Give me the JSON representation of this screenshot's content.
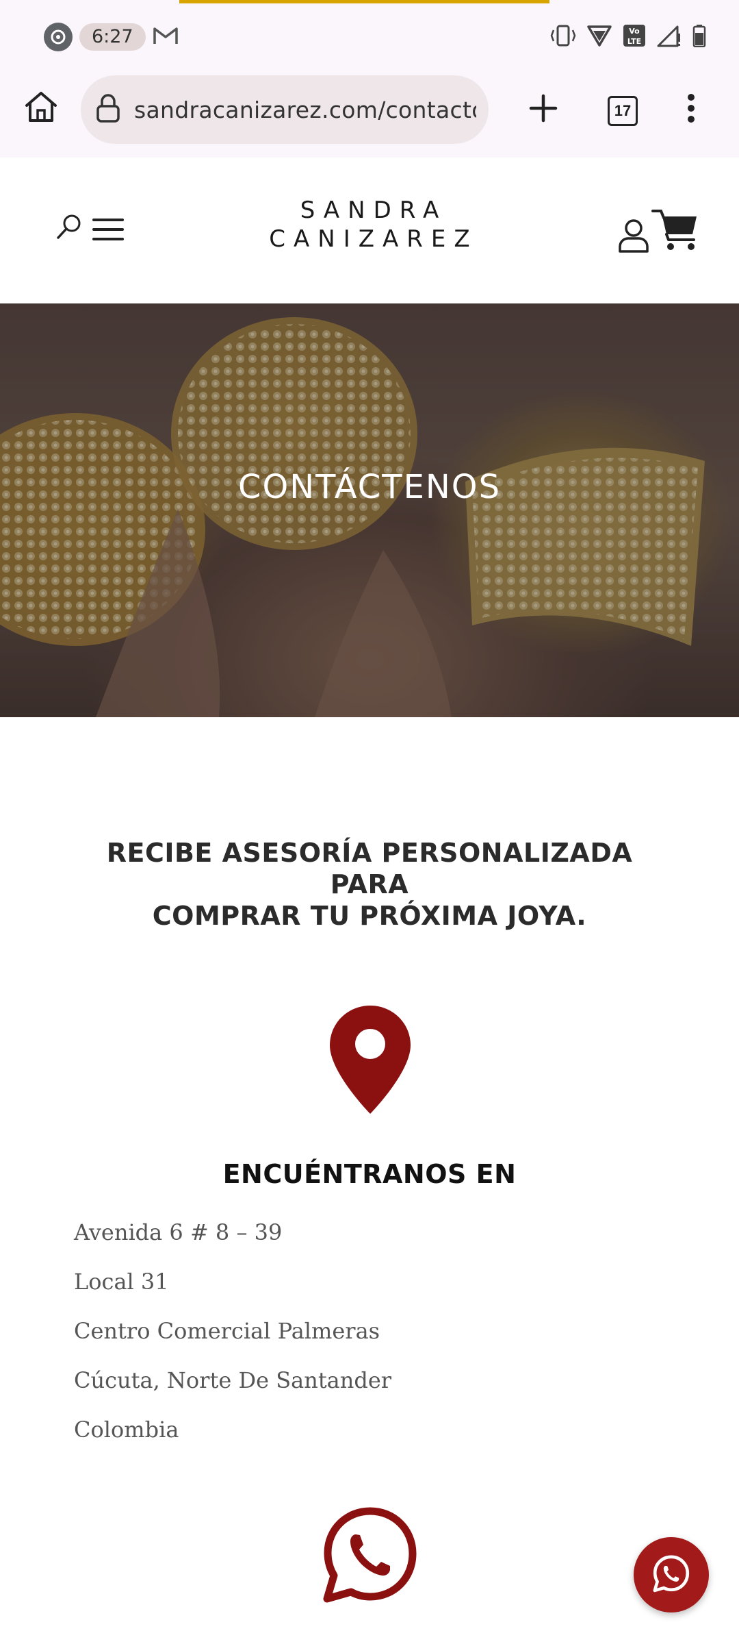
{
  "status_bar": {
    "time": "6:27"
  },
  "browser": {
    "url": "sandracanizarez.com/contacto/",
    "tab_count": "17"
  },
  "header": {
    "logo_line1": "SANDRA",
    "logo_line2": "CANIZAREZ"
  },
  "hero": {
    "title": "CONTÁCTENOS"
  },
  "content": {
    "lead_line1": "RECIBE ASESORÍA PERSONALIZADA PARA",
    "lead_line2": "COMPRAR TU PRÓXIMA JOYA.",
    "find_title": "ENCUÉNTRANOS EN",
    "address": [
      "Avenida 6 # 8 – 39",
      "Local 31",
      "Centro Comercial Palmeras",
      "Cúcuta, Norte De Santander",
      "Colombia"
    ]
  },
  "colors": {
    "brand_red": "#8b1010",
    "whatsapp_button": "#a31a1a",
    "loading_bar": "#d8a400"
  },
  "icons": {
    "home": "home-icon",
    "lock": "lock-icon",
    "new_tab": "plus-icon",
    "more": "more-vert-icon",
    "search": "search-icon",
    "menu": "hamburger-icon",
    "user": "user-icon",
    "cart": "cart-icon",
    "location": "location-pin-icon",
    "whatsapp": "whatsapp-icon"
  }
}
